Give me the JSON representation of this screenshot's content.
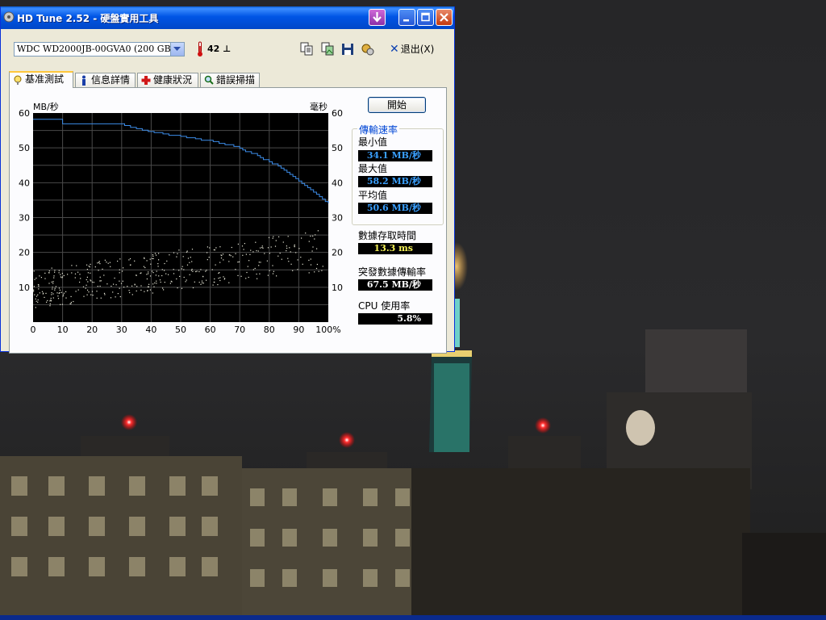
{
  "window": {
    "title": "HD Tune 2.52 - 硬盤實用工具"
  },
  "toolbar": {
    "drive": "WDC WD2000JB-00GVA0 (200 GB)",
    "temperature": "42 ⊥",
    "exit_label": "退出(X)"
  },
  "tabs": [
    "基准測試",
    "信息詳情",
    "健康狀況",
    "錯誤掃描"
  ],
  "start_button": "開始",
  "stats": {
    "transfer_group": "傳輸速率",
    "min_label": "最小值",
    "min_value": "34.1 MB/秒",
    "max_label": "最大值",
    "max_value": "58.2 MB/秒",
    "avg_label": "平均值",
    "avg_value": "50.6 MB/秒",
    "access_label": "數據存取時間",
    "access_value": "13.3 ms",
    "burst_label": "突發數據傳輸率",
    "burst_value": "67.5 MB/秒",
    "cpu_label": "CPU 使用率",
    "cpu_value": "5.8%"
  },
  "chart_data": {
    "type": "line",
    "left_unit": "MB/秒",
    "right_unit": "毫秒",
    "y_ticks": [
      "10",
      "20",
      "30",
      "40",
      "50",
      "60"
    ],
    "x_ticks": [
      "0",
      "10",
      "20",
      "30",
      "40",
      "50",
      "60",
      "70",
      "80",
      "90",
      "100%"
    ],
    "xlim": [
      0,
      100
    ],
    "ylim": [
      0,
      60
    ],
    "grid": true,
    "colors": {
      "background": "#000000",
      "grid": "#4a4a4a",
      "transfer_line": "#3c8ce8",
      "access_points": "#e8e8d8"
    },
    "series": [
      {
        "x": [
          0,
          9,
          10,
          30,
          31,
          33,
          35,
          37,
          39,
          41,
          44,
          46,
          50,
          52,
          55,
          57,
          61,
          63,
          65,
          68,
          70,
          71,
          72,
          74,
          76,
          77,
          78,
          80,
          81,
          83,
          84,
          85,
          86,
          87,
          88,
          89,
          90,
          91,
          92,
          93,
          94,
          95,
          96,
          97,
          98,
          99,
          100
        ],
        "values": [
          58.2,
          58.2,
          56.9,
          56.9,
          56.4,
          55.9,
          55.5,
          55.1,
          54.7,
          54.4,
          54.0,
          53.6,
          53.3,
          52.9,
          52.6,
          52.2,
          51.8,
          51.3,
          50.9,
          50.4,
          49.9,
          49.4,
          48.9,
          48.4,
          47.8,
          47.2,
          46.6,
          46.0,
          45.4,
          44.8,
          44.2,
          43.6,
          43.0,
          42.4,
          41.8,
          41.2,
          40.5,
          39.8,
          39.2,
          38.6,
          38.0,
          37.3,
          36.7,
          36.0,
          35.3,
          34.6,
          34.1
        ]
      }
    ],
    "access_time_scatter": {
      "x_range": [
        0,
        99
      ],
      "y_min_start": 4,
      "y_min_end": 15,
      "y_max_start": 15,
      "y_max_end": 27,
      "count": 420
    }
  }
}
